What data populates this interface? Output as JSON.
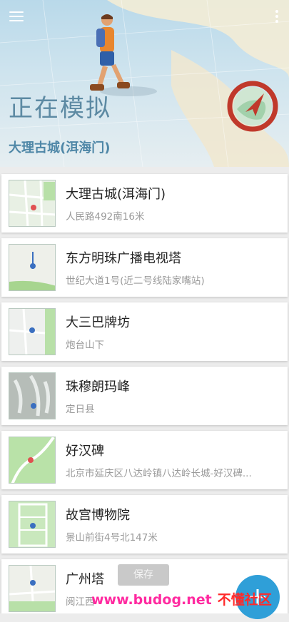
{
  "header": {
    "title": "正在模拟",
    "subtitle": "大理古城(洱海门)",
    "menu_icon": "menu-icon",
    "more_icon": "more-vert-icon",
    "compass_icon": "compass-icon"
  },
  "places": [
    {
      "name": "大理古城(洱海门)",
      "address": "人民路492南16米"
    },
    {
      "name": "东方明珠广播电视塔",
      "address": "世纪大道1号(近二号线陆家嘴站)"
    },
    {
      "name": "大三巴牌坊",
      "address": "炮台山下"
    },
    {
      "name": "珠穆朗玛峰",
      "address": "定日县"
    },
    {
      "name": "好汉碑",
      "address": "北京市延庆区八达岭镇八达岭长城-好汉碑..."
    },
    {
      "name": "故宫博物院",
      "address": "景山前街4号北147米"
    },
    {
      "name": "广州塔",
      "address": "阅江西"
    }
  ],
  "toast": {
    "save_label": "保存"
  },
  "watermark": {
    "site": "www.budog.net",
    "name": "不懂社区"
  },
  "colors": {
    "accent": "#2f9fd8",
    "title": "#5d8aa3",
    "compass": "#c0392b"
  }
}
